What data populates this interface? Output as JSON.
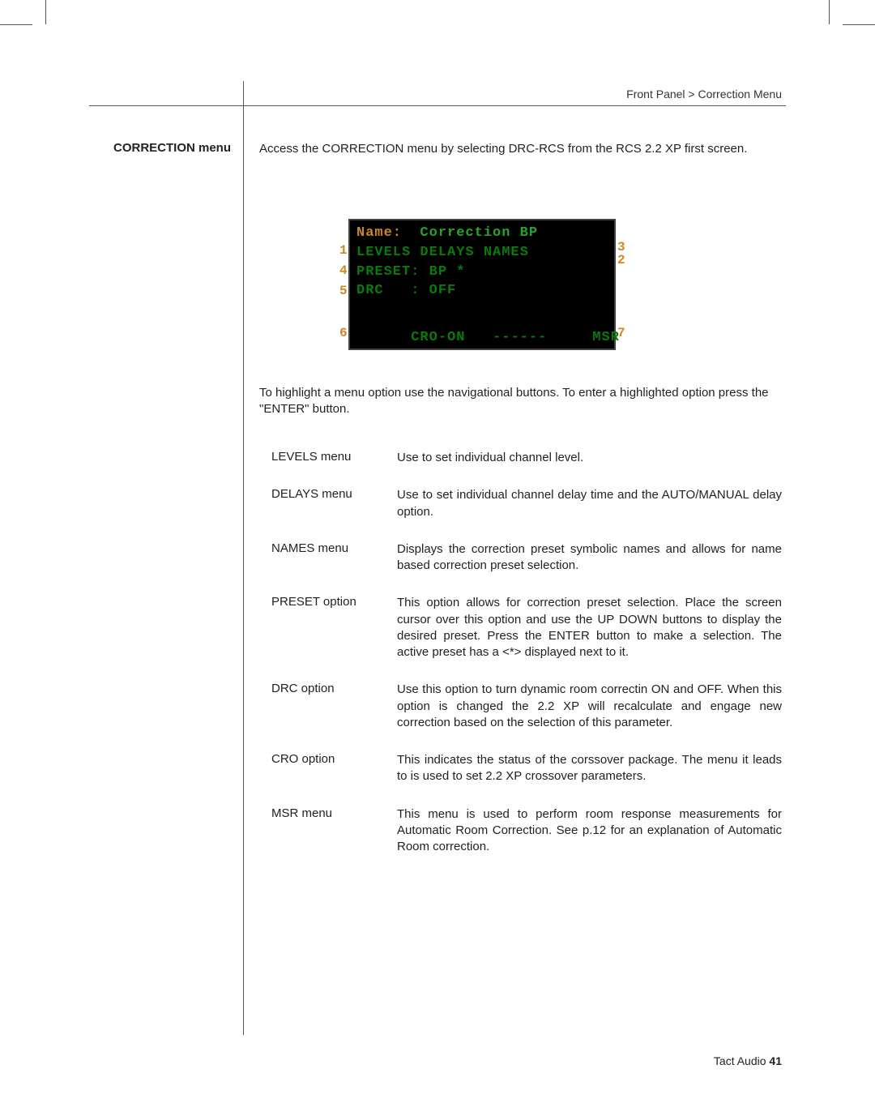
{
  "breadcrumb": "Front Panel > Correction Menu",
  "side_heading": "CORRECTION menu",
  "intro": "Access the CORRECTION menu by selecting DRC-RCS from the RCS 2.2 XP first screen.",
  "lcd": {
    "title_label": "Name:",
    "title_value": "Correction BP",
    "row1": "LEVELS DELAYS NAMES",
    "row2": "PRESET: BP *",
    "row3": "DRC   : OFF",
    "row4_left": "CRO-ON",
    "row4_mid": "------",
    "row4_right": "MSR",
    "callouts": {
      "c1": "1",
      "c2": "2",
      "c3": "3",
      "c4": "4",
      "c5": "5",
      "c6": "6",
      "c7": "7"
    }
  },
  "post_illus": "To highlight a menu option use the navigational buttons. To enter a highlighted option press the \"ENTER\" button.",
  "defs": [
    {
      "term": "LEVELS menu",
      "desc": "Use to set individual channel level."
    },
    {
      "term": "DELAYS menu",
      "desc": "Use to set individual channel delay time and the AUTO/MANUAL delay option."
    },
    {
      "term": "NAMES menu",
      "desc": "Displays the correction preset symbolic names and allows for name based correction preset selection."
    },
    {
      "term": "PRESET option",
      "desc": "This option allows for correction preset selection. Place the screen cursor over this option and use the UP DOWN buttons to display the desired preset. Press the ENTER button to make a selection. The active preset has a <*> displayed next to it."
    },
    {
      "term": "DRC option",
      "desc": "Use this option to turn dynamic room correctin ON and OFF. When this option is changed the 2.2 XP will recalculate and engage new correction based on the selection of this parameter."
    },
    {
      "term": "CRO option",
      "desc": "This indicates the status of the corssover package. The menu it leads to is used to set 2.2 XP crossover parameters."
    },
    {
      "term": "MSR menu",
      "desc": "This menu is used to perform room response measurements for Automatic Room Correction. See p.12 for an explanation of Automatic Room correction."
    }
  ],
  "footer_text": "Tact Audio ",
  "footer_page": "41"
}
